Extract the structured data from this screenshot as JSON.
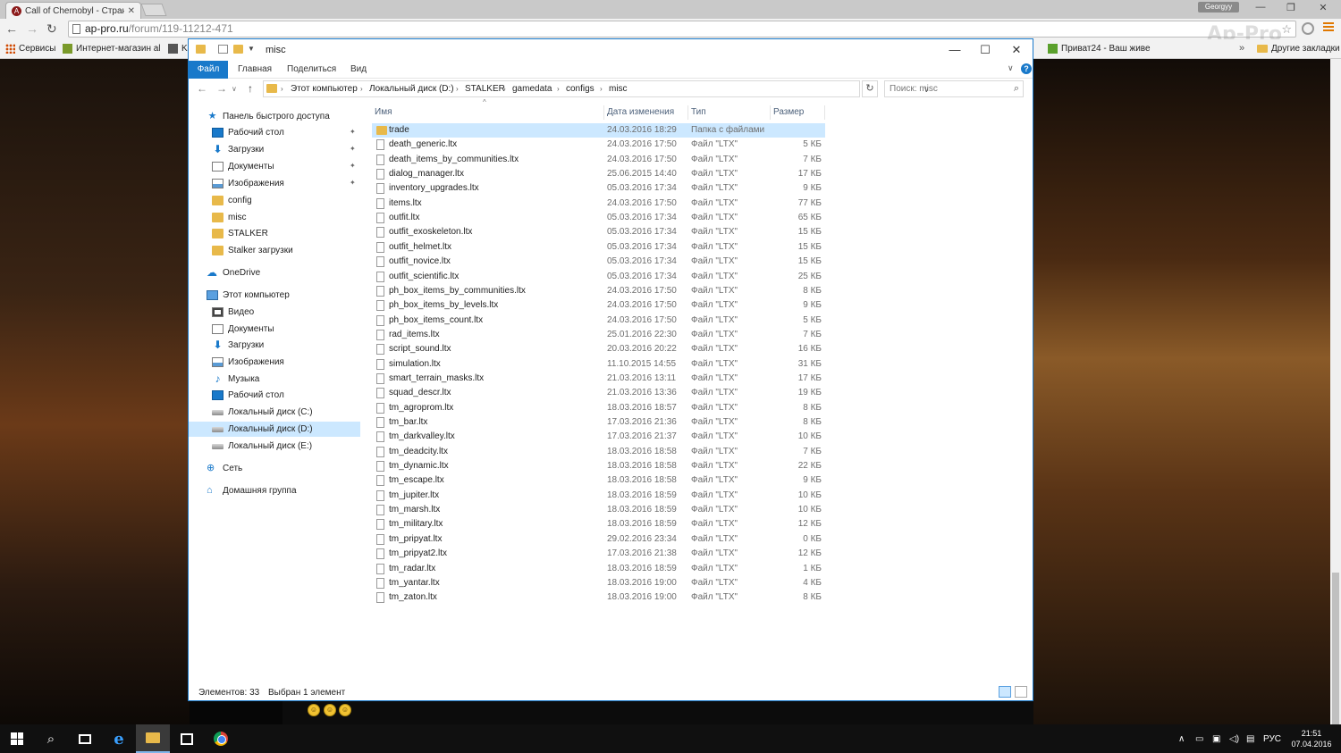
{
  "browser": {
    "tab_title": "Call of Chernobyl - Стран",
    "tab_favicon": "A",
    "profile_name": "Georgyy",
    "url_domain": "ap-pro.ru",
    "url_path": "/forum/119-11212-471",
    "bookmarks": [
      {
        "label": "Сервисы",
        "icon": "apps-grid-icon"
      },
      {
        "label": "Интернет-магазин al",
        "icon": "shop-icon"
      },
      {
        "label": "K",
        "icon": "bookmark-k-icon"
      },
      {
        "label": "Приват24 - Ваш живе",
        "icon": "privat24-icon"
      }
    ],
    "other_bookmarks": "Другие закладки",
    "more_bookmarks": "»"
  },
  "explorer": {
    "title": "misc",
    "ribbon": {
      "file": "Файл",
      "tabs": [
        "Главная",
        "Поделиться",
        "Вид"
      ]
    },
    "breadcrumb": [
      "Этот компьютер",
      "Локальный диск (D:)",
      "STALKER",
      "gamedata",
      "configs",
      "misc"
    ],
    "search_placeholder": "Поиск: misc",
    "nav": [
      {
        "label": "Панель быстрого доступа",
        "icon": "star",
        "level": 0
      },
      {
        "label": "Рабочий стол",
        "icon": "desktop",
        "level": 1,
        "pinned": true
      },
      {
        "label": "Загрузки",
        "icon": "down",
        "level": 1,
        "pinned": true
      },
      {
        "label": "Документы",
        "icon": "doc",
        "level": 1,
        "pinned": true
      },
      {
        "label": "Изображения",
        "icon": "img",
        "level": 1,
        "pinned": true
      },
      {
        "label": "config",
        "icon": "folder",
        "level": 1
      },
      {
        "label": "misc",
        "icon": "folder",
        "level": 1
      },
      {
        "label": "STALKER",
        "icon": "folder",
        "level": 1
      },
      {
        "label": "Stalker загрузки",
        "icon": "folder",
        "level": 1
      },
      {
        "label": "OneDrive",
        "icon": "cloud",
        "level": 0
      },
      {
        "label": "Этот компьютер",
        "icon": "pc",
        "level": 0
      },
      {
        "label": "Видео",
        "icon": "video",
        "level": 1
      },
      {
        "label": "Документы",
        "icon": "doc",
        "level": 1
      },
      {
        "label": "Загрузки",
        "icon": "down",
        "level": 1
      },
      {
        "label": "Изображения",
        "icon": "img",
        "level": 1
      },
      {
        "label": "Музыка",
        "icon": "music",
        "level": 1
      },
      {
        "label": "Рабочий стол",
        "icon": "desktop",
        "level": 1
      },
      {
        "label": "Локальный диск (C:)",
        "icon": "drive",
        "level": 1
      },
      {
        "label": "Локальный диск (D:)",
        "icon": "drive",
        "level": 1,
        "selected": true
      },
      {
        "label": "Локальный диск (E:)",
        "icon": "drive",
        "level": 1
      },
      {
        "label": "Сеть",
        "icon": "net",
        "level": 0
      },
      {
        "label": "Домашняя группа",
        "icon": "home",
        "level": 0
      }
    ],
    "columns": [
      "Имя",
      "Дата изменения",
      "Тип",
      "Размер"
    ],
    "files": [
      {
        "name": "trade",
        "date": "24.03.2016 18:29",
        "type": "Папка с файлами",
        "size": "",
        "folder": true,
        "selected": true
      },
      {
        "name": "death_generic.ltx",
        "date": "24.03.2016 17:50",
        "type": "Файл \"LTX\"",
        "size": "5 КБ"
      },
      {
        "name": "death_items_by_communities.ltx",
        "date": "24.03.2016 17:50",
        "type": "Файл \"LTX\"",
        "size": "7 КБ"
      },
      {
        "name": "dialog_manager.ltx",
        "date": "25.06.2015 14:40",
        "type": "Файл \"LTX\"",
        "size": "17 КБ"
      },
      {
        "name": "inventory_upgrades.ltx",
        "date": "05.03.2016 17:34",
        "type": "Файл \"LTX\"",
        "size": "9 КБ"
      },
      {
        "name": "items.ltx",
        "date": "24.03.2016 17:50",
        "type": "Файл \"LTX\"",
        "size": "77 КБ"
      },
      {
        "name": "outfit.ltx",
        "date": "05.03.2016 17:34",
        "type": "Файл \"LTX\"",
        "size": "65 КБ"
      },
      {
        "name": "outfit_exoskeleton.ltx",
        "date": "05.03.2016 17:34",
        "type": "Файл \"LTX\"",
        "size": "15 КБ"
      },
      {
        "name": "outfit_helmet.ltx",
        "date": "05.03.2016 17:34",
        "type": "Файл \"LTX\"",
        "size": "15 КБ"
      },
      {
        "name": "outfit_novice.ltx",
        "date": "05.03.2016 17:34",
        "type": "Файл \"LTX\"",
        "size": "15 КБ"
      },
      {
        "name": "outfit_scientific.ltx",
        "date": "05.03.2016 17:34",
        "type": "Файл \"LTX\"",
        "size": "25 КБ"
      },
      {
        "name": "ph_box_items_by_communities.ltx",
        "date": "24.03.2016 17:50",
        "type": "Файл \"LTX\"",
        "size": "8 КБ"
      },
      {
        "name": "ph_box_items_by_levels.ltx",
        "date": "24.03.2016 17:50",
        "type": "Файл \"LTX\"",
        "size": "9 КБ"
      },
      {
        "name": "ph_box_items_count.ltx",
        "date": "24.03.2016 17:50",
        "type": "Файл \"LTX\"",
        "size": "5 КБ"
      },
      {
        "name": "rad_items.ltx",
        "date": "25.01.2016 22:30",
        "type": "Файл \"LTX\"",
        "size": "7 КБ"
      },
      {
        "name": "script_sound.ltx",
        "date": "20.03.2016 20:22",
        "type": "Файл \"LTX\"",
        "size": "16 КБ"
      },
      {
        "name": "simulation.ltx",
        "date": "11.10.2015 14:55",
        "type": "Файл \"LTX\"",
        "size": "31 КБ"
      },
      {
        "name": "smart_terrain_masks.ltx",
        "date": "21.03.2016 13:11",
        "type": "Файл \"LTX\"",
        "size": "17 КБ"
      },
      {
        "name": "squad_descr.ltx",
        "date": "21.03.2016 13:36",
        "type": "Файл \"LTX\"",
        "size": "19 КБ"
      },
      {
        "name": "tm_agroprom.ltx",
        "date": "18.03.2016 18:57",
        "type": "Файл \"LTX\"",
        "size": "8 КБ"
      },
      {
        "name": "tm_bar.ltx",
        "date": "17.03.2016 21:36",
        "type": "Файл \"LTX\"",
        "size": "8 КБ"
      },
      {
        "name": "tm_darkvalley.ltx",
        "date": "17.03.2016 21:37",
        "type": "Файл \"LTX\"",
        "size": "10 КБ"
      },
      {
        "name": "tm_deadcity.ltx",
        "date": "18.03.2016 18:58",
        "type": "Файл \"LTX\"",
        "size": "7 КБ"
      },
      {
        "name": "tm_dynamic.ltx",
        "date": "18.03.2016 18:58",
        "type": "Файл \"LTX\"",
        "size": "22 КБ"
      },
      {
        "name": "tm_escape.ltx",
        "date": "18.03.2016 18:58",
        "type": "Файл \"LTX\"",
        "size": "9 КБ"
      },
      {
        "name": "tm_jupiter.ltx",
        "date": "18.03.2016 18:59",
        "type": "Файл \"LTX\"",
        "size": "10 КБ"
      },
      {
        "name": "tm_marsh.ltx",
        "date": "18.03.2016 18:59",
        "type": "Файл \"LTX\"",
        "size": "10 КБ"
      },
      {
        "name": "tm_military.ltx",
        "date": "18.03.2016 18:59",
        "type": "Файл \"LTX\"",
        "size": "12 КБ"
      },
      {
        "name": "tm_pripyat.ltx",
        "date": "29.02.2016 23:34",
        "type": "Файл \"LTX\"",
        "size": "0 КБ"
      },
      {
        "name": "tm_pripyat2.ltx",
        "date": "17.03.2016 21:38",
        "type": "Файл \"LTX\"",
        "size": "12 КБ"
      },
      {
        "name": "tm_radar.ltx",
        "date": "18.03.2016 18:59",
        "type": "Файл \"LTX\"",
        "size": "1 КБ"
      },
      {
        "name": "tm_yantar.ltx",
        "date": "18.03.2016 19:00",
        "type": "Файл \"LTX\"",
        "size": "4 КБ"
      },
      {
        "name": "tm_zaton.ltx",
        "date": "18.03.2016 19:00",
        "type": "Файл \"LTX\"",
        "size": "8 КБ"
      }
    ],
    "status_items": "Элементов: 33",
    "status_selected": "Выбран 1 элемент"
  },
  "taskbar": {
    "language": "РУС",
    "time": "21:51",
    "date": "07.04.2016"
  },
  "colors": {
    "accent": "#1979ca",
    "selection": "#cce8ff",
    "folder": "#e8b94a"
  }
}
